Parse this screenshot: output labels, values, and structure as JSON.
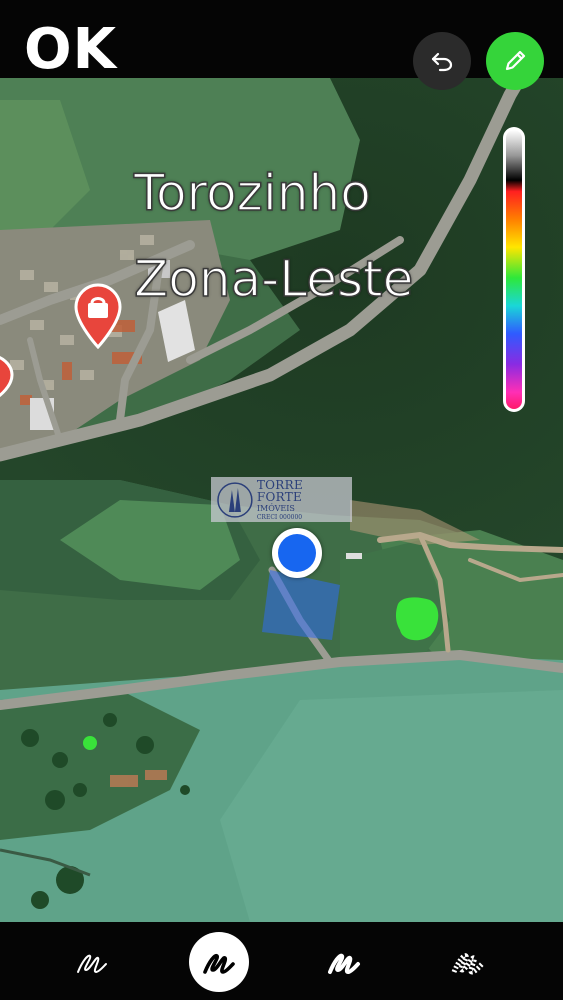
{
  "header": {
    "done_label": "OK",
    "undo_icon": "undo-icon",
    "pen_color_button_icon": "pencil-icon",
    "accent_color": "#35d43a"
  },
  "map": {
    "place_label_line1": "Torozinho",
    "place_label_line2": "Zona-Leste",
    "pins": [
      "shopping-bag-pin-icon",
      "partial-red-pin-icon"
    ],
    "current_location": "blue-dot"
  },
  "watermark": {
    "name": "TORRE FORTE",
    "subtitle": "IMÓVEIS",
    "extra": "CRECI 000000"
  },
  "color_slider": {
    "icon": "color-spectrum-slider",
    "colors": [
      "#ffffff",
      "#000000",
      "#ff2020",
      "#ff7f00",
      "#ffe600",
      "#2ee83a",
      "#1ad7d7",
      "#2f5bff",
      "#8a2be2",
      "#ff2fb5"
    ]
  },
  "brush_tools": {
    "items": [
      {
        "name": "pen",
        "icon": "pen-stroke-icon",
        "selected": false
      },
      {
        "name": "marker",
        "icon": "marker-stroke-icon",
        "selected": true
      },
      {
        "name": "neon",
        "icon": "neon-stroke-icon",
        "selected": false
      },
      {
        "name": "eraser-pattern",
        "icon": "pattern-stroke-icon",
        "selected": false
      }
    ]
  }
}
